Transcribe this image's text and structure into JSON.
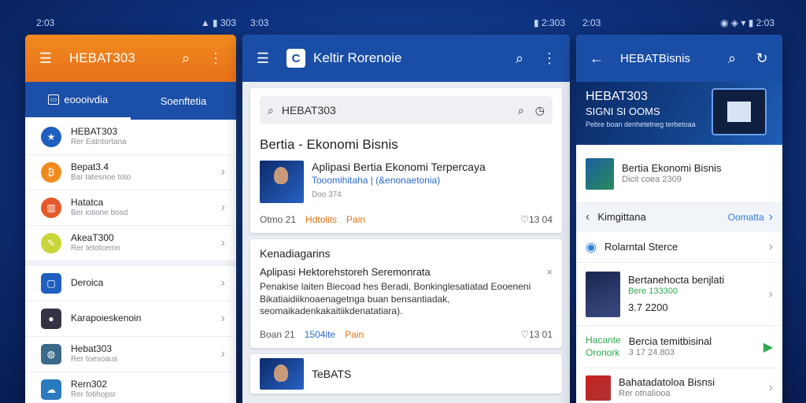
{
  "status_bars": [
    {
      "time": "2:03",
      "right": "▲ ▮ 303"
    },
    {
      "time": "3:03",
      "right": "▮ 2:303"
    },
    {
      "time": "2:03",
      "right": "◉ ◈ ▾ ▮ 2:03"
    }
  ],
  "phone1": {
    "title": "HEBAT303",
    "tabs": [
      "eoooivdia",
      "Soenftetia"
    ],
    "items": [
      {
        "title": "HEBAT303",
        "sub": "Rer Eatntortana",
        "icon": "star-icon",
        "color": "#1e5fbf",
        "chevron": false
      },
      {
        "title": "Bepat3.4",
        "sub": "Bar tatesnoe toto",
        "icon": "bitcoin-icon",
        "color": "#f08a1e",
        "chevron": true
      },
      {
        "title": "Hatatca",
        "sub": "Ber iotione bosd",
        "icon": "chart-icon",
        "color": "#e45a2a",
        "chevron": true
      },
      {
        "title": "AkeaT300",
        "sub": "Rer tetotcemn",
        "icon": "pen-icon",
        "color": "#c8d63a",
        "chevron": true
      },
      {
        "title": "Deroica",
        "sub": "",
        "icon": "square-icon",
        "color": "#1e5fbf",
        "chevron": true
      },
      {
        "title": "Karapoieskenoin",
        "sub": "",
        "icon": "person-icon",
        "color": "#334",
        "chevron": true
      },
      {
        "title": "Hebat303",
        "sub": "Rer toesoaus",
        "icon": "globe-icon",
        "color": "#3a6a8a",
        "chevron": true
      },
      {
        "title": "Rern302",
        "sub": "Rer fotihopsr",
        "icon": "leaf-icon",
        "color": "#2a7abf",
        "chevron": false
      }
    ]
  },
  "phone2": {
    "title": "Keltir Rorenoie",
    "search": {
      "value": "HEBAT303"
    },
    "section_title": "Bertia - Ekonomi Bisnis",
    "article": {
      "headline": "Aplipasi Bertia Ekonomi Terpercaya",
      "sub": "Tooomihitaha | (&enonaetonia)",
      "meta": "Doo 374",
      "actions": [
        "Otmo  21",
        "Hdtolits",
        "Pain"
      ],
      "right": "13  04"
    },
    "card2": {
      "title": "Kenadiagarins",
      "lead": "Aplipasi Hektorehstoreh Seremonrata",
      "desc": "Penakise laiten Biecoad hes Beradi, Bonkinglesatiatad Eooeneni Bikatiaidiiknoaenagetnga buan bensantiadak, seomaikadenkakaitiikdenatatiara).",
      "actions": [
        "Boan  21",
        "1504ite",
        "Pain"
      ],
      "right": "13  01"
    },
    "card3": {
      "title": "TeBATS"
    }
  },
  "phone3": {
    "title": "HEBATBisnis",
    "banner": {
      "line1": "HEBAT303",
      "line2": "SIGNI SI OOMS",
      "line3": "Pebre boan denhetetneg terbetoaa"
    },
    "items": [
      {
        "title": "Bertia Ekonomi Bisnis",
        "sub": "Dicit coea 2309"
      },
      {
        "title": "Kimgittana",
        "sub": "",
        "right": "Oomatta"
      },
      {
        "title": "Rolarntal Sterce",
        "sub": ""
      },
      {
        "title": "Bertanehocta benjlati",
        "sub": "Bere 133300",
        "sub2": "3.7  2200"
      },
      {
        "title": "Bercia temitbisinal",
        "sub": "3 17  24.803",
        "lead": "Hacante",
        "lead2": "Oronork"
      },
      {
        "title": "Bahatadatoloa Bisnsi",
        "sub": "Rer otnaliooa"
      }
    ]
  }
}
